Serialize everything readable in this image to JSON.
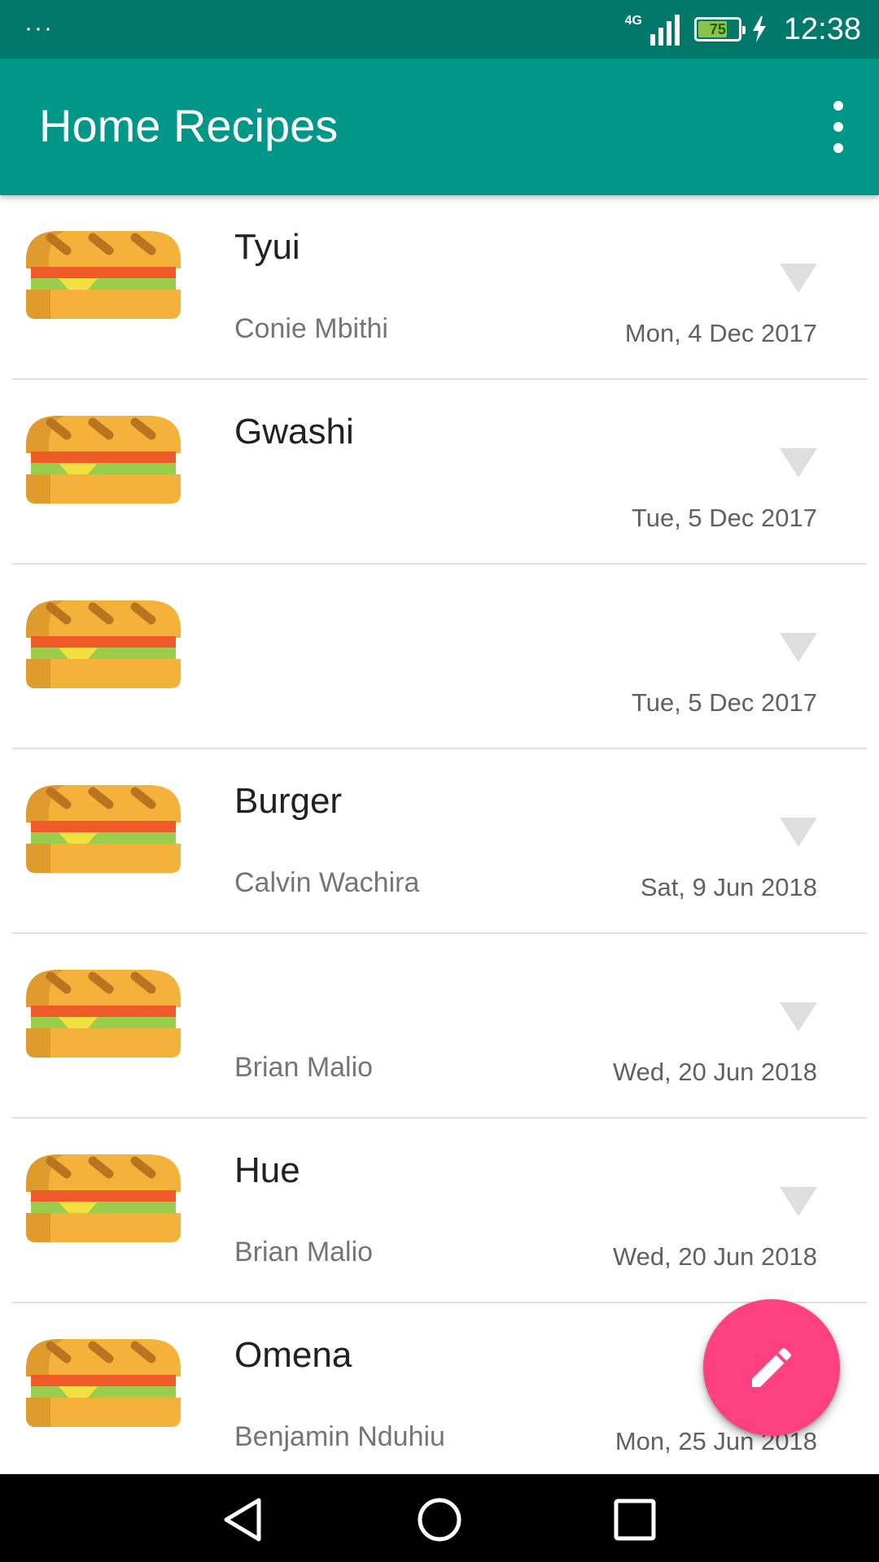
{
  "status_bar": {
    "menu_dots": "···",
    "network": "4G",
    "battery_level": "75",
    "battery_fraction": 0.75,
    "time": "12:38",
    "icons": [
      "signal-icon",
      "battery-icon",
      "charging-icon"
    ]
  },
  "app_bar": {
    "title": "Home Recipes",
    "overflow_icon": "more-vert-icon"
  },
  "recipes": [
    {
      "name": "Tyui",
      "author": "Conie Mbithi",
      "date": "Mon, 4 Dec 2017"
    },
    {
      "name": "Gwashi",
      "author": "",
      "date": "Tue, 5 Dec 2017"
    },
    {
      "name": "",
      "author": "",
      "date": "Tue, 5 Dec 2017"
    },
    {
      "name": "Burger",
      "author": "Calvin Wachira",
      "date": "Sat, 9 Jun 2018"
    },
    {
      "name": "",
      "author": "Brian Malio",
      "date": "Wed, 20 Jun 2018"
    },
    {
      "name": "Hue",
      "author": "Brian Malio",
      "date": "Wed, 20 Jun 2018"
    },
    {
      "name": "Omena",
      "author": "Benjamin Nduhiu",
      "date": "Mon, 25 Jun 2018"
    }
  ],
  "fab": {
    "icon": "edit-pencil-icon"
  },
  "colors": {
    "status_bar": "#00796b",
    "app_bar": "#009688",
    "fab": "#ff4081",
    "divider": "#e0e0e0"
  },
  "nav_bar": {
    "icons": [
      "back-icon",
      "home-icon",
      "recents-icon"
    ]
  }
}
